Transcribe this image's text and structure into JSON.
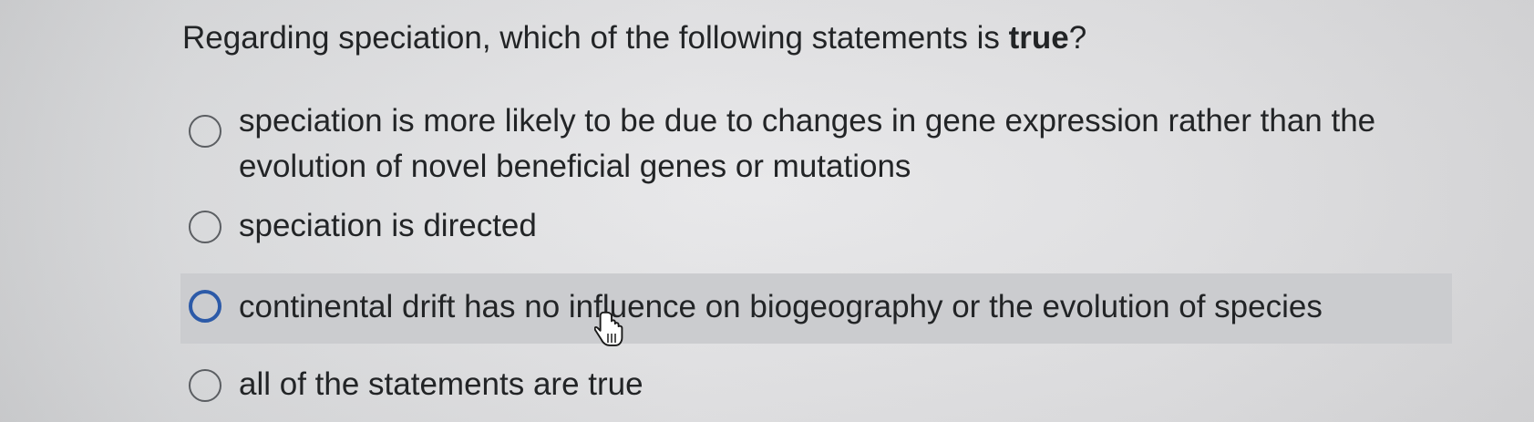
{
  "question": {
    "prefix": "Regarding speciation, which of the following statements is ",
    "emphasis": "true",
    "suffix": "?"
  },
  "options": [
    {
      "label": "speciation is more likely to be due to changes in gene expression rather than the evolution of novel beneficial genes or mutations"
    },
    {
      "label": "speciation is directed"
    },
    {
      "label": "continental drift has no influence on biogeography or the evolution of species"
    },
    {
      "label": "all of the statements are true"
    }
  ],
  "hovered_option": 3,
  "colors": {
    "hover_background": "#cbcccf",
    "radio_hover_border": "#2c5aa8",
    "text": "#222426"
  },
  "cursor_icon": "hand-pointer-icon"
}
